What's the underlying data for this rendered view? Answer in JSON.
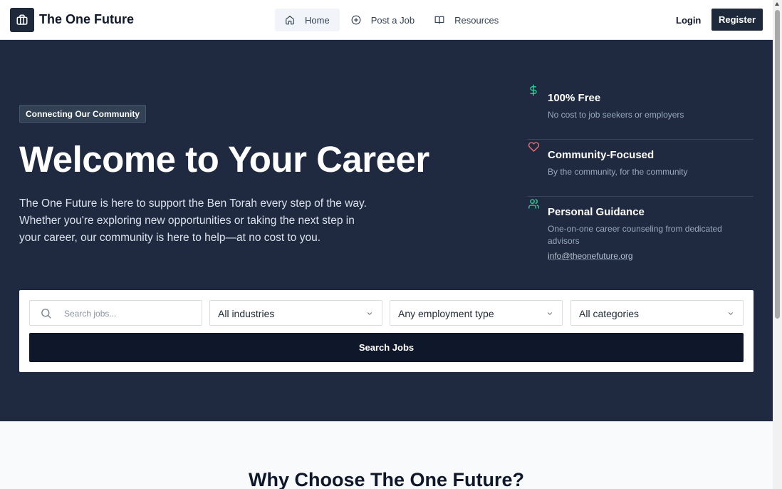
{
  "header": {
    "brand": "The One Future",
    "nav": [
      {
        "label": "Home",
        "icon": "home-icon",
        "active": true
      },
      {
        "label": "Post a Job",
        "icon": "plus-circle-icon"
      },
      {
        "label": "Resources",
        "icon": "book-icon"
      }
    ],
    "login_label": "Login",
    "register_label": "Register"
  },
  "hero": {
    "badge": "Connecting Our Community",
    "title": "Welcome to Your Career",
    "description": "The One Future is here to support the Ben Torah every step of the way. Whether you're exploring new opportunities or taking the next step in your career, our community is here to help—at no cost to you.",
    "features": [
      {
        "icon": "dollar-icon",
        "title": "100% Free",
        "description": "No cost to job seekers or employers"
      },
      {
        "icon": "heart-icon",
        "title": "Community-Focused",
        "description": "By the community, for the community"
      },
      {
        "icon": "users-icon",
        "title": "Personal Guidance",
        "description": "One-on-one career counseling from dedicated advisors",
        "email": "info@theonefuture.org"
      }
    ]
  },
  "search": {
    "placeholder": "Search jobs...",
    "industry": "All industries",
    "employment_type": "Any employment type",
    "category": "All categories",
    "button_label": "Search Jobs"
  },
  "why": {
    "title": "Why Choose The One Future?"
  },
  "colors": {
    "hero_bg": "#1f2a40",
    "primary_dark": "#0f172a",
    "dollar_icon": "#34d399",
    "heart_icon": "#f87171",
    "users_icon": "#34d399"
  }
}
